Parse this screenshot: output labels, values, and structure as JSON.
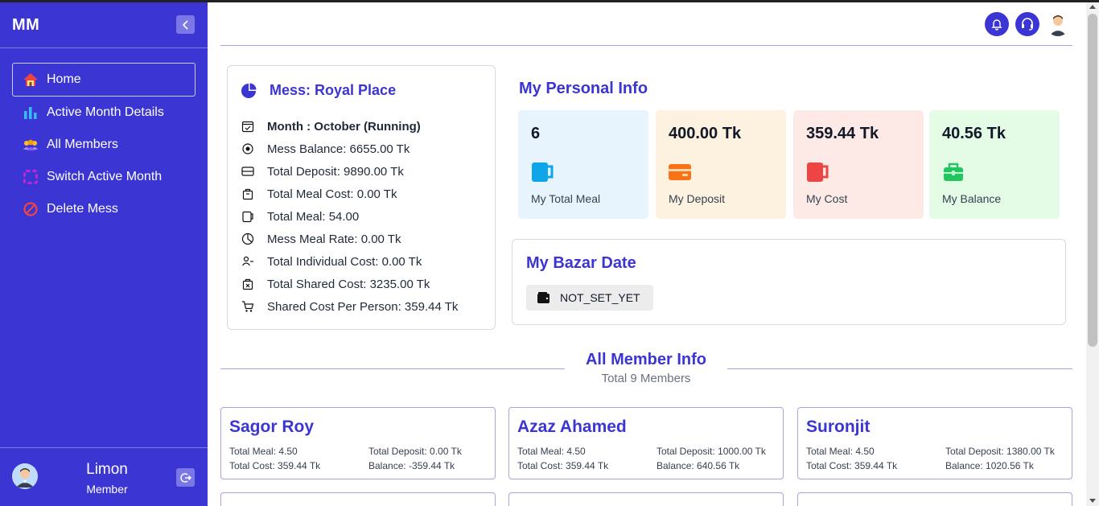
{
  "sidebar": {
    "brand": "MM",
    "nav": [
      {
        "label": "Home",
        "icon": "home-icon"
      },
      {
        "label": "Active Month Details",
        "icon": "bar-chart-icon"
      },
      {
        "label": "All Members",
        "icon": "members-icon"
      },
      {
        "label": "Switch Active Month",
        "icon": "switch-icon"
      },
      {
        "label": "Delete Mess",
        "icon": "ban-icon"
      }
    ],
    "user": {
      "name": "Limon",
      "role": "Member"
    }
  },
  "mess": {
    "title": "Mess: Royal Place",
    "rows": [
      "Month : October (Running)",
      "Mess Balance: 6655.00 Tk",
      "Total Deposit: 9890.00 Tk",
      "Total Meal Cost: 0.00 Tk",
      "Total Meal: 54.00",
      "Mess Meal Rate: 0.00 Tk",
      "Total Individual Cost: 0.00 Tk",
      "Total Shared Cost: 3235.00 Tk",
      "Shared Cost Per Person: 359.44 Tk"
    ]
  },
  "personal": {
    "title": "My Personal Info",
    "stats": [
      {
        "value": "6",
        "label": "My Total Meal",
        "bg": "#e7f3fd",
        "icon_color": "#0ea5e9",
        "icon": "mug-icon"
      },
      {
        "value": "400.00 Tk",
        "label": "My Deposit",
        "bg": "#fdf1df",
        "icon_color": "#f97316",
        "icon": "wallet-card-icon"
      },
      {
        "value": "359.44 Tk",
        "label": "My Cost",
        "bg": "#fdeae7",
        "icon_color": "#ef4444",
        "icon": "cup-icon"
      },
      {
        "value": "40.56 Tk",
        "label": "My Balance",
        "bg": "#e4fbe6",
        "icon_color": "#22c55e",
        "icon": "briefcase-icon"
      }
    ]
  },
  "bazar": {
    "title": "My Bazar Date",
    "value": "NOT_SET_YET"
  },
  "members_section": {
    "title": "All Member Info",
    "subtitle": "Total 9 Members"
  },
  "members": [
    {
      "name": "Sagor Roy",
      "total_meal": "Total Meal: 4.50",
      "total_deposit": "Total Deposit: 0.00 Tk",
      "total_cost": "Total Cost: 359.44 Tk",
      "balance": "Balance: -359.44 Tk"
    },
    {
      "name": "Azaz Ahamed",
      "total_meal": "Total Meal: 4.50",
      "total_deposit": "Total Deposit: 1000.00 Tk",
      "total_cost": "Total Cost: 359.44 Tk",
      "balance": "Balance: 640.56 Tk"
    },
    {
      "name": "Suronjit",
      "total_meal": "Total Meal: 4.50",
      "total_deposit": "Total Deposit: 1380.00 Tk",
      "total_cost": "Total Cost: 359.44 Tk",
      "balance": "Balance: 1020.56 Tk"
    }
  ],
  "colors": {
    "primary": "#3b35d3"
  }
}
